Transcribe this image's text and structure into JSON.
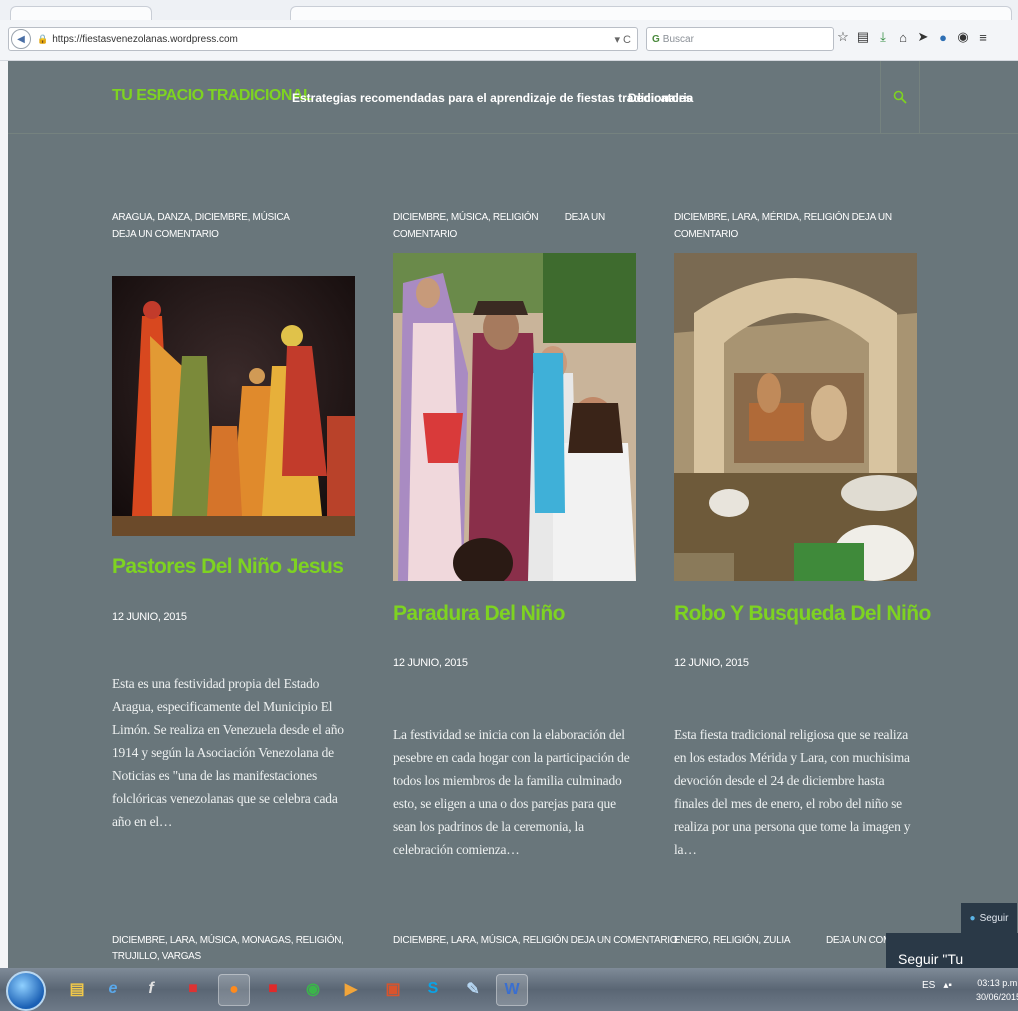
{
  "browser": {
    "url": "https://fiestasvenezolanas.wordpress.com",
    "search_placeholder": "Buscar",
    "reload_glyph": "▾ C",
    "toolbar_icons": [
      "star-icon",
      "clipboard-icon",
      "download-icon",
      "home-icon",
      "send-icon",
      "skype-icon",
      "pocket-icon",
      "menu-icon"
    ]
  },
  "site": {
    "title": "TU ESPACIO TRADICIONAL",
    "nav": [
      "Estrategias recomendadas para el aprendizaje de fiestas tradicionales",
      "Dedicatoria"
    ],
    "accent": "#7ed321",
    "background": "#69767b"
  },
  "articles": [
    {
      "meta1": "ARAGUA, DANZA, DICIEMBRE, MÚSICA",
      "meta2": "DEJA UN COMENTARIO",
      "title": "Pastores Del Niño Jesus",
      "date": "12 JUNIO, 2015",
      "excerpt": "Esta es una festividad propia del Estado Aragua, especificamente del Municipio El Limón. Se realiza en Venezuela desde el año 1914 y según la Asociación Venezolana de Noticias es \"una de las manifestaciones folclóricas venezolanas que se celebra cada año en el…"
    },
    {
      "meta1": "DICIEMBRE, MÚSICA, RELIGIÓN",
      "meta2": "DEJA UN COMENTARIO",
      "title": "Paradura Del Niño",
      "date": "12 JUNIO, 2015",
      "excerpt": "La festividad se inicia con la elaboración del pesebre en cada hogar con la participación de todos los miembros de la familia culminado esto, se eligen a una o dos parejas para que sean los padrinos de la ceremonia, la celebración comienza…"
    },
    {
      "meta1": "DICIEMBRE, LARA, MÉRIDA, RELIGIÓN DEJA UN COMENTARIO",
      "meta2": "",
      "title": "Robo Y Busqueda Del Niño",
      "date": "12 JUNIO, 2015",
      "excerpt": "Esta fiesta tradicional religiosa que se realiza en los estados Mérida y Lara, con muchisima devoción desde el 24 de diciembre hasta finales del mes de enero, el robo del niño se realiza por una persona que tome la imagen y la…"
    }
  ],
  "row2": [
    "DICIEMBRE, LARA, MÚSICA, MONAGAS, RELIGIÓN, TRUJILLO, VARGAS",
    "DICIEMBRE, LARA, MÚSICA, RELIGIÓN DEJA UN COMENTARIO",
    "ENERO, RELIGIÓN, ZULIA",
    "DEJA UN COME"
  ],
  "follow": {
    "button": "Seguir",
    "panel": "Seguir \"Tu"
  },
  "taskbar": {
    "apps": [
      "explorer-icon",
      "ie-icon",
      "flash-icon",
      "acrobat-icon",
      "firefox-icon",
      "pdf-icon",
      "chrome-icon",
      "media-icon",
      "powerpoint-icon",
      "skype-icon",
      "paint-icon",
      "word-icon"
    ],
    "lang": "ES",
    "time": "03:13 p.m.",
    "date": "30/06/2015"
  }
}
